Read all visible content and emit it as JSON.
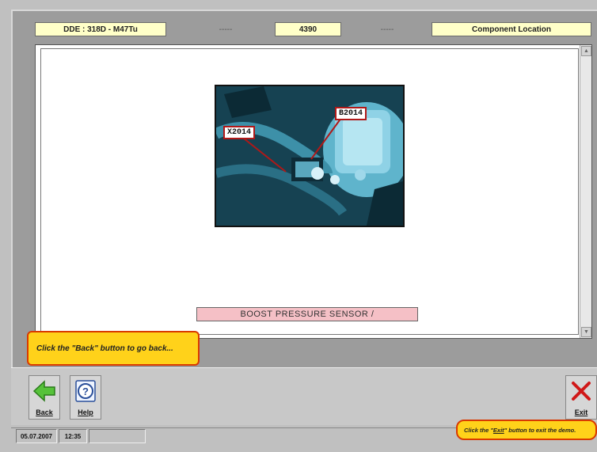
{
  "header": {
    "ecu": "DDE : 318D - M47Tu",
    "dash_left": "-----",
    "code": "4390",
    "dash_right": "-----",
    "section": "Component Location"
  },
  "figure": {
    "callout_left": "X2014",
    "callout_right": "B2014",
    "caption": "BOOST PRESSURE SENSOR /"
  },
  "tips": {
    "back": "Click the \"Back\" button to go back...",
    "exit_prefix": "Click the \"",
    "exit_word": "Exit",
    "exit_suffix": "\" button to exit the demo."
  },
  "toolbar": {
    "back_label": "Back",
    "help_label": "Help",
    "exit_label": "Exit"
  },
  "status": {
    "date": "05.07.2007",
    "time": "12:35",
    "empty": ""
  },
  "colors": {
    "tip_fill": "#ffd21a",
    "tip_border": "#d93a00",
    "header_fill": "#ffffc8",
    "caption_fill": "#f5c0c6"
  }
}
